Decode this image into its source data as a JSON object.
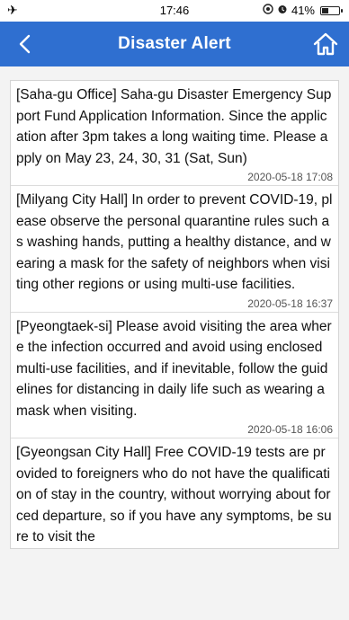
{
  "status_bar": {
    "time": "17:46",
    "battery": "41%",
    "battery_level": 0.41,
    "left_icon": "airplane-mode-icon",
    "icons": [
      "location-icon",
      "alarm-icon"
    ]
  },
  "header": {
    "title": "Disaster Alert",
    "background_color": "#2f6fd0",
    "back_icon": "back-chevron-icon",
    "home_icon": "home-icon"
  },
  "alerts": [
    {
      "message": "[Saha-gu Office] Saha-gu Disaster Emergency Support Fund Application Information. Since the application after 3pm takes a long waiting time. Please apply on May 23, 24, 30, 31 (Sat, Sun)",
      "timestamp": "2020-05-18 17:08"
    },
    {
      "message": "[Milyang City Hall] In order to prevent COVID-19, please observe the personal quarantine rules such as washing hands, putting a healthy distance, and wearing a mask for the safety of neighbors when visiting other regions or using multi-use facilities.",
      "timestamp": "2020-05-18 16:37"
    },
    {
      "message": "[Pyeongtaek-si] Please avoid visiting the area where the infection occurred and avoid using enclosed multi-use facilities, and if inevitable, follow the guidelines for distancing in daily life such as wearing a mask when visiting.",
      "timestamp": "2020-05-18 16:06"
    },
    {
      "message": "[Gyeongsan City Hall] Free COVID-19 tests are provided to foreigners who do not have the qualification of stay in the country, without worrying about forced departure, so if you have any symptoms, be sure to visit the",
      "timestamp": ""
    }
  ]
}
